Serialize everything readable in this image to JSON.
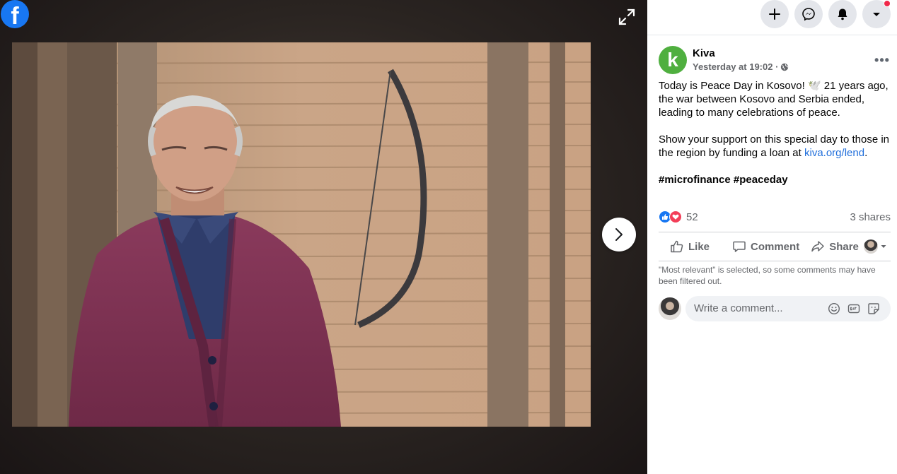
{
  "app": {
    "logo_icon": "facebook-logo",
    "logo_letter": "f",
    "brand_color": "#1877f2"
  },
  "viewer": {
    "expand_icon": "expand-icon",
    "next_icon": "chevron-right-icon"
  },
  "topbar": {
    "buttons": [
      {
        "icon": "plus-icon"
      },
      {
        "icon": "messenger-icon"
      },
      {
        "icon": "bell-icon"
      },
      {
        "icon": "caret-down-icon",
        "has_notification_dot": true
      }
    ]
  },
  "post": {
    "avatar_letter": "k",
    "author": "Kiva",
    "time": "Yesterday at 19:02 ·",
    "privacy_icon": "globe-icon",
    "more_icon": "more-horizontal-icon",
    "more_label": "•••",
    "paragraph1": "Today is Peace Day in Kosovo! 🕊️ 21 years ago, the war between Kosovo and Serbia ended, leading to many celebrations of peace.",
    "paragraph2_prefix": "Show your support on this special day to those in the region by funding a loan at ",
    "paragraph2_link": "kiva.org/lend",
    "paragraph2_suffix": ".",
    "hashtags": [
      "#microfinance",
      "#peaceday"
    ],
    "reaction_count": "52",
    "shares": "3 shares",
    "accent_link_color": "#216fdb"
  },
  "actions": {
    "like": "Like",
    "comment": "Comment",
    "share": "Share"
  },
  "comments": {
    "filter_note": "\"Most relevant\" is selected, so some comments may have been filtered out.",
    "placeholder": "Write a comment...",
    "icons": [
      "emoji-icon",
      "gif-icon",
      "sticker-icon"
    ]
  }
}
